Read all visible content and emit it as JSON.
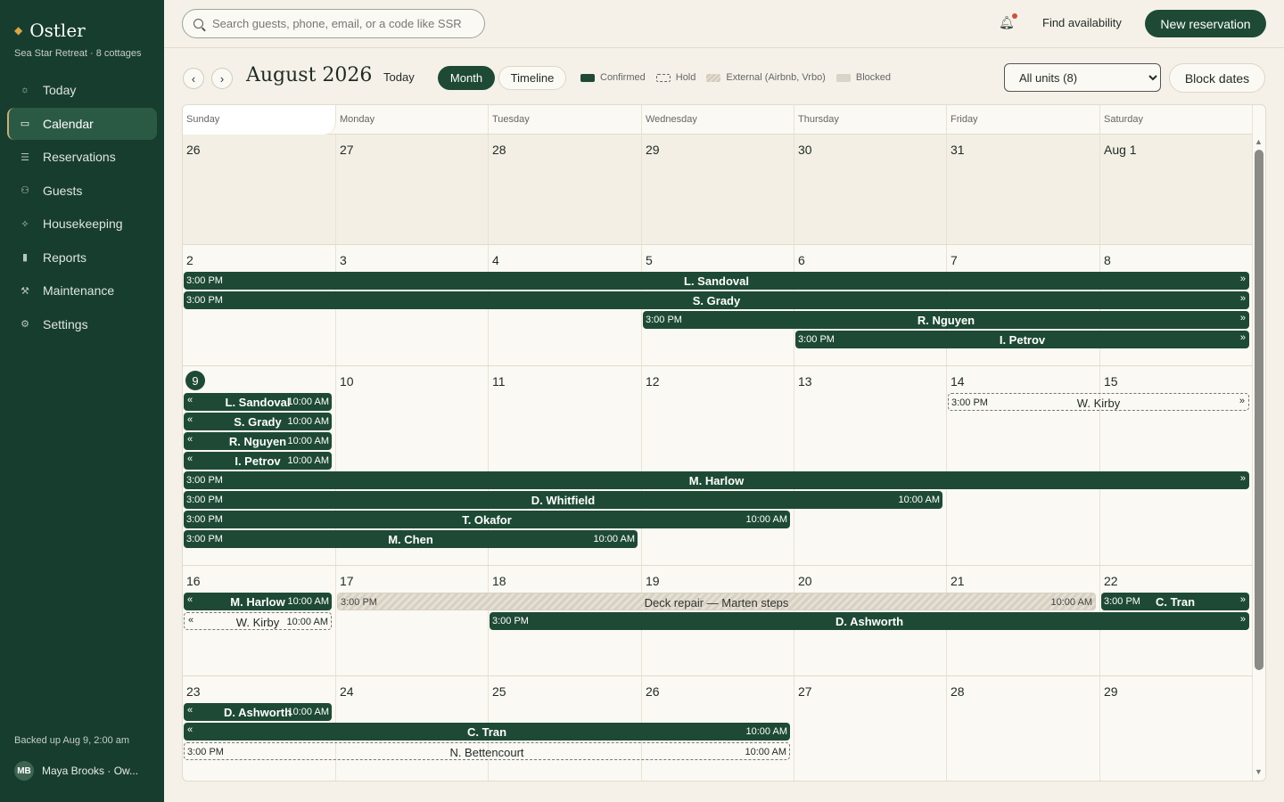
{
  "brand": {
    "name": "Ostler",
    "subtitle": "Sea Star Retreat · 8 cottages"
  },
  "sidebar": {
    "items": [
      {
        "label": "Today",
        "icon": "sun-icon",
        "glyph": "☼"
      },
      {
        "label": "Calendar",
        "icon": "calendar-icon",
        "glyph": "▭",
        "active": true
      },
      {
        "label": "Reservations",
        "icon": "list-icon",
        "glyph": "☰"
      },
      {
        "label": "Guests",
        "icon": "person-icon",
        "glyph": "⚇"
      },
      {
        "label": "Housekeeping",
        "icon": "sparkle-icon",
        "glyph": "✧"
      },
      {
        "label": "Reports",
        "icon": "bar-chart-icon",
        "glyph": "▮"
      },
      {
        "label": "Maintenance",
        "icon": "wrench-icon",
        "glyph": "⚒"
      },
      {
        "label": "Settings",
        "icon": "gear-icon",
        "glyph": "⚙"
      }
    ],
    "backup": "Backed up Aug 9, 2:00 am",
    "user": {
      "initials": "MB",
      "name": "Maya Brooks · Ow..."
    }
  },
  "topbar": {
    "search_placeholder": "Search guests, phone, email, or a code like SSR",
    "find_label": "Find availability",
    "new_label": "New reservation"
  },
  "toolbar": {
    "prev": "‹",
    "next": "›",
    "month_title": "August 2026",
    "today_label": "Today",
    "view_month": "Month",
    "view_timeline": "Timeline",
    "legend": [
      {
        "label": "Confirmed",
        "kind": "confirmed"
      },
      {
        "label": "Hold",
        "kind": "hold"
      },
      {
        "label": "External (Airbnb, Vrbo)",
        "kind": "external"
      },
      {
        "label": "Blocked",
        "kind": "blocked"
      }
    ],
    "unit_options": [
      "All units (8)"
    ],
    "block_label": "Block dates"
  },
  "calendar": {
    "weekdays": [
      "Sunday",
      "Monday",
      "Tuesday",
      "Wednesday",
      "Thursday",
      "Friday",
      "Saturday"
    ],
    "weeks": [
      {
        "days": [
          "26",
          "27",
          "28",
          "29",
          "30",
          "31",
          "Aug 1"
        ],
        "dim": [
          true,
          true,
          true,
          true,
          true,
          true,
          true
        ],
        "today": -1
      },
      {
        "days": [
          "2",
          "3",
          "4",
          "5",
          "6",
          "7",
          "8"
        ],
        "dim": [],
        "today": -1
      },
      {
        "days": [
          "9",
          "10",
          "11",
          "12",
          "13",
          "14",
          "15"
        ],
        "dim": [],
        "today": 0
      },
      {
        "days": [
          "16",
          "17",
          "18",
          "19",
          "20",
          "21",
          "22"
        ],
        "dim": [],
        "today": -1
      },
      {
        "days": [
          "23",
          "24",
          "25",
          "26",
          "27",
          "28",
          "29"
        ],
        "dim": [],
        "today": -1
      }
    ],
    "bookings": [
      {
        "week": 1,
        "lane": 0,
        "start": 0,
        "end": 7,
        "name": "L. Sandoval",
        "time_in": "3:00 PM",
        "time_out": "",
        "cont_left": false,
        "cont_right": true,
        "kind": "confirmed"
      },
      {
        "week": 1,
        "lane": 1,
        "start": 0,
        "end": 7,
        "name": "S. Grady",
        "time_in": "3:00 PM",
        "time_out": "",
        "cont_left": false,
        "cont_right": true,
        "kind": "confirmed"
      },
      {
        "week": 1,
        "lane": 2,
        "start": 3,
        "end": 7,
        "name": "R. Nguyen",
        "time_in": "3:00 PM",
        "time_out": "",
        "cont_left": false,
        "cont_right": true,
        "kind": "confirmed"
      },
      {
        "week": 1,
        "lane": 3,
        "start": 4,
        "end": 7,
        "name": "I. Petrov",
        "time_in": "3:00 PM",
        "time_out": "",
        "cont_left": false,
        "cont_right": true,
        "kind": "confirmed"
      },
      {
        "week": 2,
        "lane": 0,
        "start": 0,
        "end": 1,
        "name": "L. Sandoval",
        "time_in": "",
        "time_out": "10:00 AM",
        "cont_left": true,
        "cont_right": false,
        "kind": "confirmed"
      },
      {
        "week": 2,
        "lane": 1,
        "start": 0,
        "end": 1,
        "name": "S. Grady",
        "time_in": "",
        "time_out": "10:00 AM",
        "cont_left": true,
        "cont_right": false,
        "kind": "confirmed"
      },
      {
        "week": 2,
        "lane": 2,
        "start": 0,
        "end": 1,
        "name": "R. Nguyen",
        "time_in": "",
        "time_out": "10:00 AM",
        "cont_left": true,
        "cont_right": false,
        "kind": "confirmed"
      },
      {
        "week": 2,
        "lane": 3,
        "start": 0,
        "end": 1,
        "name": "I. Petrov",
        "time_in": "",
        "time_out": "10:00 AM",
        "cont_left": true,
        "cont_right": false,
        "kind": "confirmed"
      },
      {
        "week": 2,
        "lane": 0,
        "start": 5,
        "end": 7,
        "name": "W. Kirby",
        "time_in": "3:00 PM",
        "time_out": "",
        "cont_left": false,
        "cont_right": true,
        "kind": "hold"
      },
      {
        "week": 2,
        "lane": 4,
        "start": 0,
        "end": 7,
        "name": "M. Harlow",
        "time_in": "3:00 PM",
        "time_out": "",
        "cont_left": false,
        "cont_right": true,
        "kind": "confirmed"
      },
      {
        "week": 2,
        "lane": 5,
        "start": 0,
        "end": 5,
        "name": "D. Whitfield",
        "time_in": "3:00 PM",
        "time_out": "10:00 AM",
        "cont_left": false,
        "cont_right": false,
        "kind": "confirmed"
      },
      {
        "week": 2,
        "lane": 6,
        "start": 0,
        "end": 4,
        "name": "T. Okafor",
        "time_in": "3:00 PM",
        "time_out": "10:00 AM",
        "cont_left": false,
        "cont_right": false,
        "kind": "confirmed"
      },
      {
        "week": 2,
        "lane": 7,
        "start": 0,
        "end": 3,
        "name": "M. Chen",
        "time_in": "3:00 PM",
        "time_out": "10:00 AM",
        "cont_left": false,
        "cont_right": false,
        "kind": "confirmed"
      },
      {
        "week": 3,
        "lane": 0,
        "start": 0,
        "end": 1,
        "name": "M. Harlow",
        "time_in": "",
        "time_out": "10:00 AM",
        "cont_left": true,
        "cont_right": false,
        "kind": "confirmed"
      },
      {
        "week": 3,
        "lane": 1,
        "start": 0,
        "end": 1,
        "name": "W. Kirby",
        "time_in": "",
        "time_out": "10:00 AM",
        "cont_left": true,
        "cont_right": false,
        "kind": "hold"
      },
      {
        "week": 3,
        "lane": 0,
        "start": 1,
        "end": 6,
        "name": "Deck repair — Marten steps",
        "time_in": "3:00 PM",
        "time_out": "10:00 AM",
        "cont_left": false,
        "cont_right": false,
        "kind": "blocked"
      },
      {
        "week": 3,
        "lane": 0,
        "start": 6,
        "end": 7,
        "name": "C. Tran",
        "time_in": "3:00 PM",
        "time_out": "",
        "cont_left": false,
        "cont_right": true,
        "kind": "confirmed"
      },
      {
        "week": 3,
        "lane": 1,
        "start": 2,
        "end": 7,
        "name": "D. Ashworth",
        "time_in": "3:00 PM",
        "time_out": "",
        "cont_left": false,
        "cont_right": true,
        "kind": "confirmed"
      },
      {
        "week": 4,
        "lane": 0,
        "start": 0,
        "end": 1,
        "name": "D. Ashworth",
        "time_in": "",
        "time_out": "10:00 AM",
        "cont_left": true,
        "cont_right": false,
        "kind": "confirmed"
      },
      {
        "week": 4,
        "lane": 1,
        "start": 0,
        "end": 4,
        "name": "C. Tran",
        "time_in": "",
        "time_out": "10:00 AM",
        "cont_left": true,
        "cont_right": false,
        "kind": "confirmed"
      },
      {
        "week": 4,
        "lane": 2,
        "start": 0,
        "end": 4,
        "name": "N. Bettencourt",
        "time_in": "3:00 PM",
        "time_out": "10:00 AM",
        "cont_left": false,
        "cont_right": false,
        "kind": "hold"
      }
    ],
    "scroll_up": "▲",
    "scroll_down": "▼"
  }
}
